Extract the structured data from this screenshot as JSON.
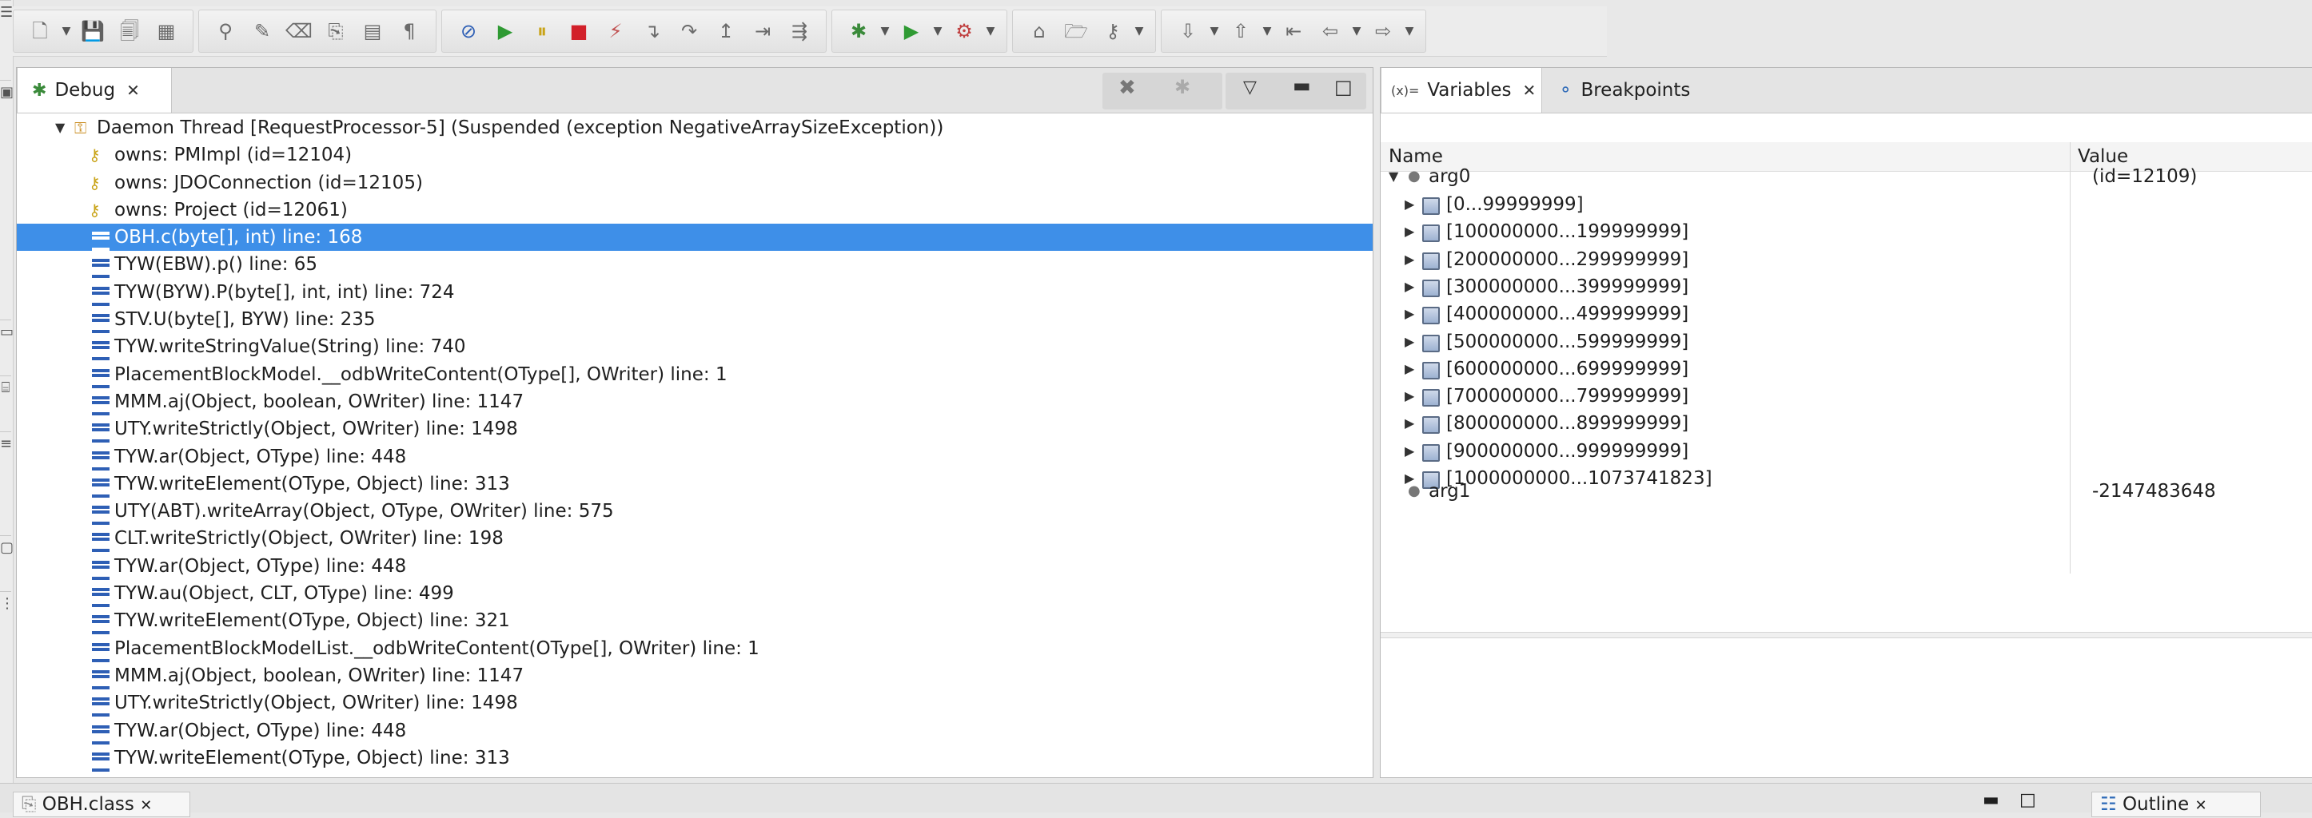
{
  "toolbar": {
    "groups": [
      [
        {
          "name": "new-wizard-icon",
          "g": "🗋",
          "dd": true
        },
        {
          "name": "save-icon",
          "g": "💾"
        },
        {
          "name": "save-all-icon",
          "g": "🗐"
        },
        {
          "name": "build-icon",
          "g": "▦"
        }
      ],
      [
        {
          "name": "toggle-breakpoint-icon",
          "g": "⚲"
        },
        {
          "name": "edit-tool-icon",
          "g": "✎"
        },
        {
          "name": "clear-icon",
          "g": "⌫"
        },
        {
          "name": "copy-icon",
          "g": "⎘"
        },
        {
          "name": "paste-icon",
          "g": "▤"
        },
        {
          "name": "paragraph-icon",
          "g": "¶"
        }
      ],
      [
        {
          "name": "skip-breakpoints-icon",
          "g": "⊘"
        },
        {
          "name": "resume-icon",
          "g": "▶"
        },
        {
          "name": "suspend-icon",
          "g": "⏸"
        },
        {
          "name": "terminate-icon",
          "g": "■"
        },
        {
          "name": "disconnect-icon",
          "g": "⚡"
        },
        {
          "name": "step-into-icon",
          "g": "↴"
        },
        {
          "name": "step-over-icon",
          "g": "↷"
        },
        {
          "name": "step-return-icon",
          "g": "↥"
        },
        {
          "name": "drop-to-frame-icon",
          "g": "⇥"
        },
        {
          "name": "use-step-filters-icon",
          "g": "⇶"
        }
      ],
      [
        {
          "name": "debug-icon",
          "g": "✱",
          "dd": true
        },
        {
          "name": "run-icon",
          "g": "▶",
          "dd": true
        },
        {
          "name": "external-tools-icon",
          "g": "⚙",
          "dd": true
        }
      ],
      [
        {
          "name": "open-type-icon",
          "g": "⌂"
        },
        {
          "name": "open-folder-icon",
          "g": "🗁"
        },
        {
          "name": "search-icon",
          "g": "⚷",
          "dd": true
        }
      ],
      [
        {
          "name": "next-annotation-icon",
          "g": "⇩",
          "dd": true
        },
        {
          "name": "previous-annotation-icon",
          "g": "⇧",
          "dd": true
        },
        {
          "name": "last-edit-location-icon",
          "g": "⇤"
        },
        {
          "name": "back-icon",
          "g": "⇦",
          "dd": true
        },
        {
          "name": "forward-icon",
          "g": "⇨",
          "dd": true
        }
      ]
    ]
  },
  "debug": {
    "tab_label": "Debug",
    "thread": "Daemon Thread [RequestProcessor-5] (Suspended (exception NegativeArraySizeException))",
    "monitors": [
      "owns: PMImpl  (id=12104)",
      "owns: JDOConnection  (id=12105)",
      "owns: Project  (id=12061)"
    ],
    "frames": [
      "OBH.c(byte[], int) line: 168",
      "TYW(EBW).p() line: 65",
      "TYW(BYW).P(byte[], int, int) line: 724",
      "STV.U(byte[], BYW) line: 235",
      "TYW.writeStringValue(String) line: 740",
      "PlacementBlockModel.__odbWriteContent(OType[], OWriter) line: 1",
      "MMM.aj(Object, boolean, OWriter) line: 1147",
      "UTY.writeStrictly(Object, OWriter) line: 1498",
      "TYW.ar(Object, OType) line: 448",
      "TYW.writeElement(OType, Object) line: 313",
      "UTY(ABT).writeArray(Object, OType, OWriter) line: 575",
      "CLT.writeStrictly(Object, OWriter) line: 198",
      "TYW.ar(Object, OType) line: 448",
      "TYW.au(Object, CLT, OType) line: 499",
      "TYW.writeElement(OType, Object) line: 321",
      "PlacementBlockModelList.__odbWriteContent(OType[], OWriter) line: 1",
      "MMM.aj(Object, boolean, OWriter) line: 1147",
      "UTY.writeStrictly(Object, OWriter) line: 1498",
      "TYW.ar(Object, OType) line: 448",
      "TYW.writeElement(OType, Object) line: 313"
    ],
    "selected_frame": 0
  },
  "variables": {
    "tab_label": "Variables",
    "tab_icon": "(x)=",
    "breakpoints_label": "Breakpoints",
    "col_name": "Name",
    "col_value": "Value",
    "arg0": {
      "name": "arg0",
      "value": "(id=12109)"
    },
    "ranges": [
      "[0...99999999]",
      "[100000000...199999999]",
      "[200000000...299999999]",
      "[300000000...399999999]",
      "[400000000...499999999]",
      "[500000000...599999999]",
      "[600000000...699999999]",
      "[700000000...799999999]",
      "[800000000...899999999]",
      "[900000000...999999999]",
      "[1000000000...1073741823]"
    ],
    "arg1": {
      "name": "arg1",
      "value": "-2147483648"
    }
  },
  "bottom": {
    "editor_tab": "OBH.class",
    "outline_tab": "Outline"
  }
}
